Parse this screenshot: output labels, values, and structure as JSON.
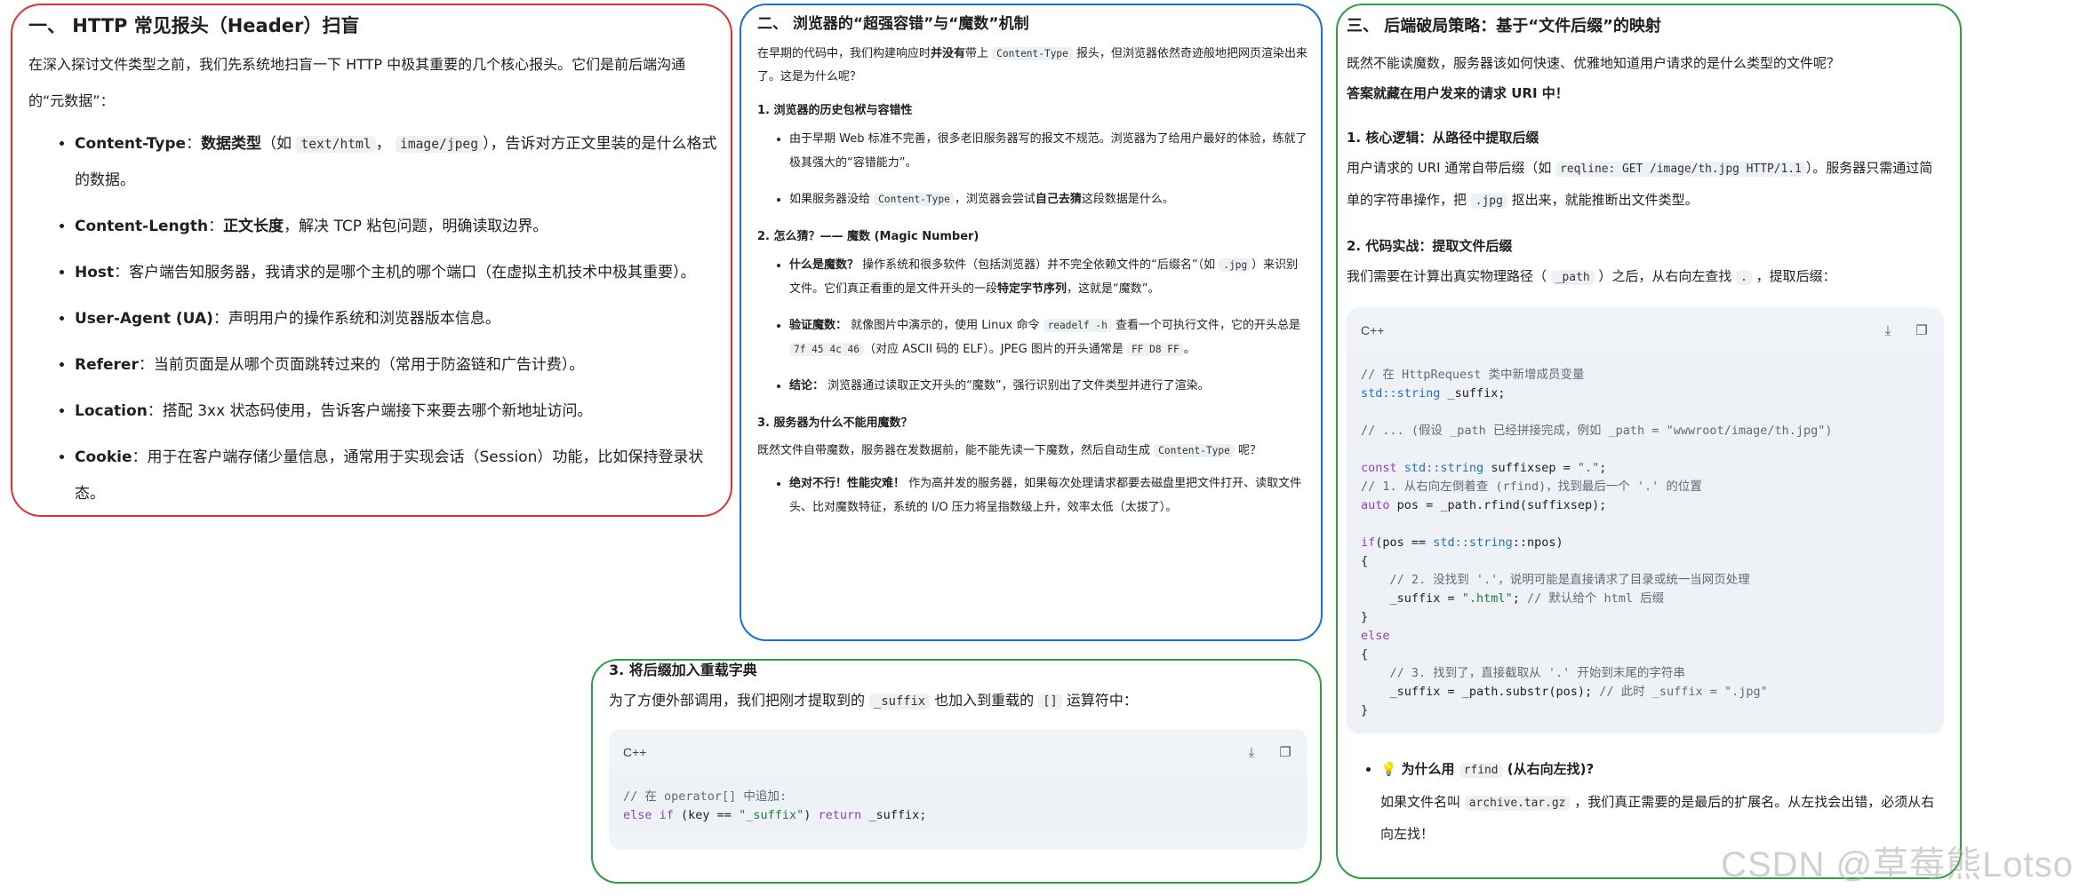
{
  "panel1": {
    "title": "一、 HTTP 常见报头（Header）扫盲",
    "intro": "在深入探讨文件类型之前，我们先系统地扫盲一下 HTTP 中极其重要的几个核心报头。它们是前后端沟通的“元数据”：",
    "items": [
      {
        "head": "Content-Type",
        "sep": "：",
        "bold": "数据类型",
        "pre": "（如 ",
        "code1": "text/html",
        "mid": "，",
        "code2": "image/jpeg",
        "post": "），告诉对方正文里装的是什么格式的数据。"
      },
      {
        "head": "Content-Length",
        "sep": "：",
        "bold": "正文长度",
        "post": "，解决 TCP 粘包问题，明确读取边界。"
      },
      {
        "head": "Host",
        "sep": "：",
        "post": "客户端告知服务器，我请求的是哪个主机的哪个端口（在虚拟主机技术中极其重要）。"
      },
      {
        "head": "User-Agent (UA)",
        "sep": "：",
        "post": "声明用户的操作系统和浏览器版本信息。"
      },
      {
        "head": "Referer",
        "sep": "：",
        "post": "当前页面是从哪个页面跳转过来的（常用于防盗链和广告计费）。"
      },
      {
        "head": "Location",
        "sep": "：",
        "post": "搭配 3xx 状态码使用，告诉客户端接下来要去哪个新地址访问。"
      },
      {
        "head": "Cookie",
        "sep": "：",
        "post": "用于在客户端存储少量信息，通常用于实现会话（Session）功能，比如保持登录状态。"
      }
    ]
  },
  "panel2": {
    "title": "二、 浏览器的“超强容错”与“魔数”机制",
    "intro_a": "在早期的代码中，我们构建响应时",
    "intro_bold": "并没有",
    "intro_b": "带上 ",
    "intro_code": "Content-Type",
    "intro_c": " 报头，但浏览器依然奇迹般地把网页渲染出来了。这是为什么呢？",
    "s1": {
      "title": "1. 浏览器的历史包袱与容错性",
      "li1": "由于早期 Web 标准不完善，很多老旧服务器写的报文不规范。浏览器为了给用户最好的体验，练就了极其强大的“容错能力”。",
      "li2_a": "如果服务器没给 ",
      "li2_code": "Content-Type",
      "li2_b": "，浏览器会尝试",
      "li2_bold": "自己去猜",
      "li2_c": "这段数据是什么。"
    },
    "s2": {
      "title": "2. 怎么猜？—— 魔数 (Magic Number)",
      "li1_bold": "什么是魔数？",
      "li1_a": " 操作系统和很多软件（包括浏览器）并不完全依赖文件的“后缀名”（如 ",
      "li1_code": ".jpg",
      "li1_b": "）来识别文件。它们真正看重的是文件开头的一段",
      "li1_bold2": "特定字节序列",
      "li1_c": "，这就是“魔数”。",
      "li2_bold": "验证魔数：",
      "li2_a": " 就像图片中演示的，使用 Linux 命令 ",
      "li2_code1": "readelf -h",
      "li2_b": " 查看一个可执行文件，它的开头总是 ",
      "li2_code2": "7f 45 4c 46",
      "li2_c": "（对应 ASCII 码的 ELF）。JPEG 图片的开头通常是 ",
      "li2_code3": "FF D8 FF",
      "li2_d": "。",
      "li3_bold": "结论：",
      "li3_a": " 浏览器通过读取正文开头的“魔数”，强行识别出了文件类型并进行了渲染。"
    },
    "s3": {
      "title": "3. 服务器为什么不能用魔数？",
      "p_a": "既然文件自带魔数，服务器在发数据前，能不能先读一下魔数，然后自动生成 ",
      "p_code": "Content-Type",
      "p_b": " 呢？",
      "li1_bold": "绝对不行！性能灾难！",
      "li1_a": " 作为高并发的服务器，如果每次处理请求都要去磁盘里把文件打开、读取文件头、比对魔数特征，系统的 I/O 压力将呈指数级上升，效率太低（太拔了）。"
    }
  },
  "panel3": {
    "title": "三、 后端破局策略：基于“文件后缀”的映射",
    "q": "既然不能读魔数，服务器该如何快速、优雅地知道用户请求的是什么类型的文件呢？",
    "a": "答案就藏在用户发来的请求 URI 中！",
    "s1": {
      "title": "1. 核心逻辑：从路径中提取后缀",
      "p_a": "用户请求的 URI 通常自带后缀（如 ",
      "p_code1": "reqline: GET /image/th.jpg HTTP/1.1",
      "p_b": "）。服务器只需通过简单的字符串操作，把 ",
      "p_code2": ".jpg",
      "p_c": " 抠出来，就能推断出文件类型。"
    },
    "s2": {
      "title": "2. 代码实战：提取文件后缀",
      "p_a": "我们需要在计算出真实物理路径（ ",
      "p_code1": "_path",
      "p_b": " ）之后，从右向左查找 ",
      "p_code2": ".",
      "p_c": " ，提取后缀："
    },
    "code_lang": "C++",
    "tip": {
      "emoji": "💡",
      "bold_a": "为什么用 ",
      "code": "rfind",
      "bold_b": " (从右向左找)?",
      "p_a": "如果文件名叫 ",
      "p_code": "archive.tar.gz",
      "p_b": " ，我们真正需要的是最后的扩展名。从左找会出错，必须从右向左找！"
    }
  },
  "panel4": {
    "title": "3. 将后缀加入重载字典",
    "p_a": "为了方便外部调用，我们把刚才提取到的 ",
    "p_code1": "_suffix",
    "p_b": " 也加入到重载的 ",
    "p_code2": "[]",
    "p_c": " 运算符中：",
    "code_lang": "C++"
  },
  "watermark": "CSDN @草莓熊Lotso"
}
